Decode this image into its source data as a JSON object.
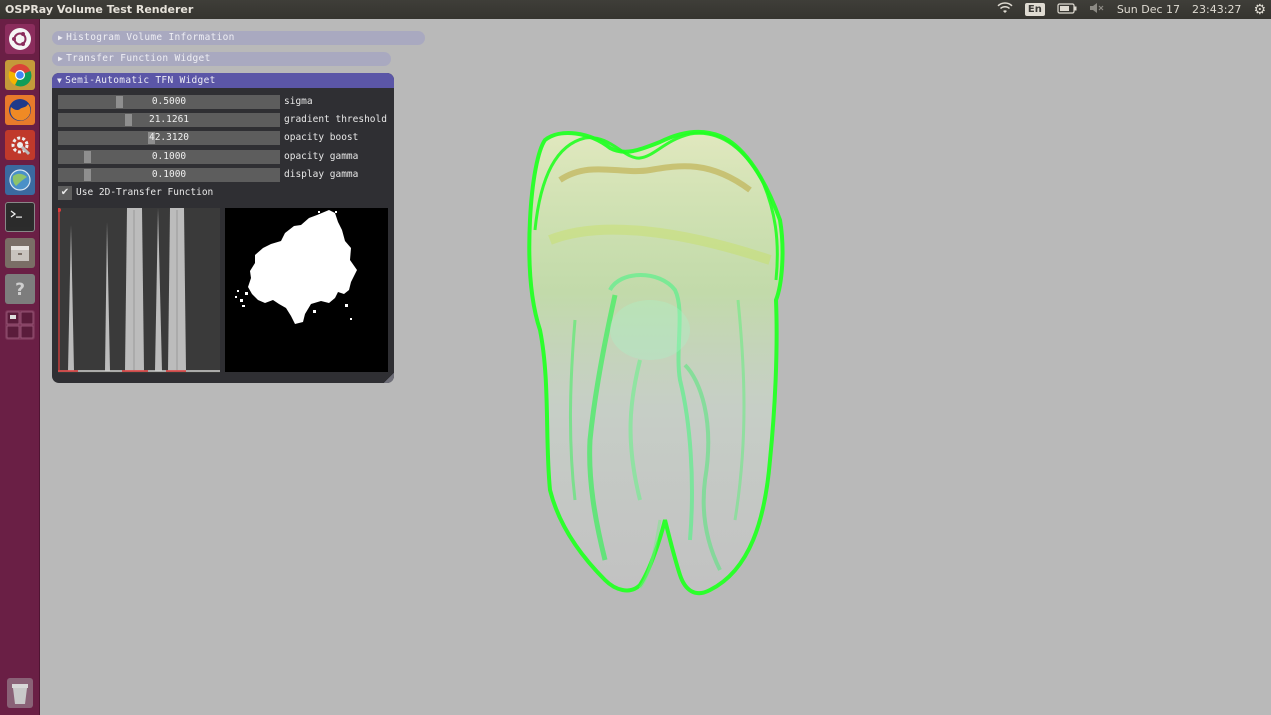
{
  "window": {
    "title": "OSPRay Volume Test Renderer"
  },
  "tray": {
    "language": "En",
    "date": "Sun Dec 17",
    "time": "23:43:27",
    "icons": [
      "wifi-icon",
      "language-indicator",
      "battery-icon",
      "volume-muted-icon",
      "gear-icon"
    ]
  },
  "launcher": {
    "items": [
      "ubuntu-logo-icon",
      "chrome-icon",
      "firefox-icon",
      "system-settings-icon",
      "globe-app-icon",
      "terminal-icon",
      "files-icon",
      "help-icon",
      "workspace-switcher-icon"
    ],
    "trash": "trash-icon"
  },
  "panels": {
    "histogram": {
      "label": "Histogram Volume Information",
      "expanded": false
    },
    "transfer": {
      "label": "Transfer Function Widget",
      "expanded": false
    },
    "semi_auto": {
      "label": "Semi-Automatic TFN Widget",
      "expanded": true,
      "sliders": [
        {
          "label": "sigma",
          "value": "0.5000",
          "level": 0.27
        },
        {
          "label": "gradient threshold",
          "value": "21.1261",
          "level": 0.31
        },
        {
          "label": "opacity boost",
          "value": "42.3120",
          "level": 0.42
        },
        {
          "label": "opacity gamma",
          "value": "0.1000",
          "level": 0.12
        },
        {
          "label": "display gamma",
          "value": "0.1000",
          "level": 0.12
        }
      ],
      "checkbox": {
        "label": "Use 2D-Transfer Function",
        "checked": true
      }
    }
  },
  "colors": {
    "title_active": "#5b56a7",
    "collapsed_header": "#a9a9c0",
    "launcher": "#6a1f45",
    "background": "#b9b9b9",
    "render_green": "#22ff22"
  }
}
